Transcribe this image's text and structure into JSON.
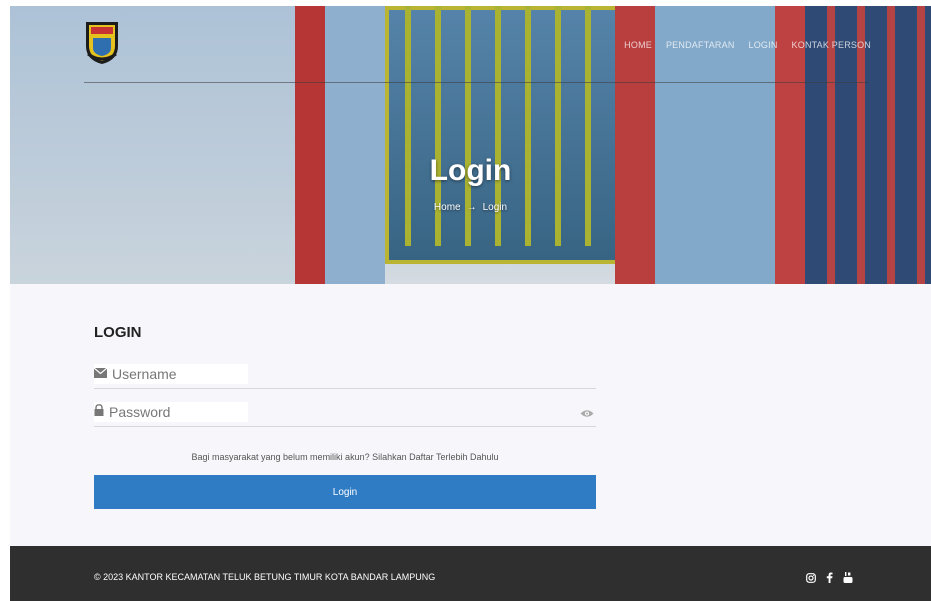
{
  "nav": {
    "items": [
      "HOME",
      "PENDAFTARAN",
      "LOGIN",
      "KONTAK PERSON"
    ]
  },
  "hero": {
    "title": "Login",
    "breadcrumb_home": "Home",
    "breadcrumb_arrow": "→",
    "breadcrumb_current": "Login"
  },
  "form": {
    "heading": "LOGIN",
    "username_placeholder": "Username",
    "password_placeholder": "Password",
    "hint": "Bagi masyarakat yang belum memiliki akun? Silahkan Daftar Terlebih Dahulu",
    "submit_label": "Login"
  },
  "footer": {
    "copyright": "© 2023 KANTOR KECAMATAN TELUK BETUNG TIMUR KOTA BANDAR LAMPUNG"
  },
  "icons": {
    "logo": "city-emblem-logo",
    "username": "envelope-icon",
    "password": "lock-icon",
    "toggle": "eye-icon",
    "social": [
      "instagram-icon",
      "facebook-icon",
      "youtube-icon"
    ]
  },
  "colors": {
    "primary": "#2f7cc4",
    "footer_bg": "#2f2f2f",
    "main_bg": "#f7f7fb"
  }
}
